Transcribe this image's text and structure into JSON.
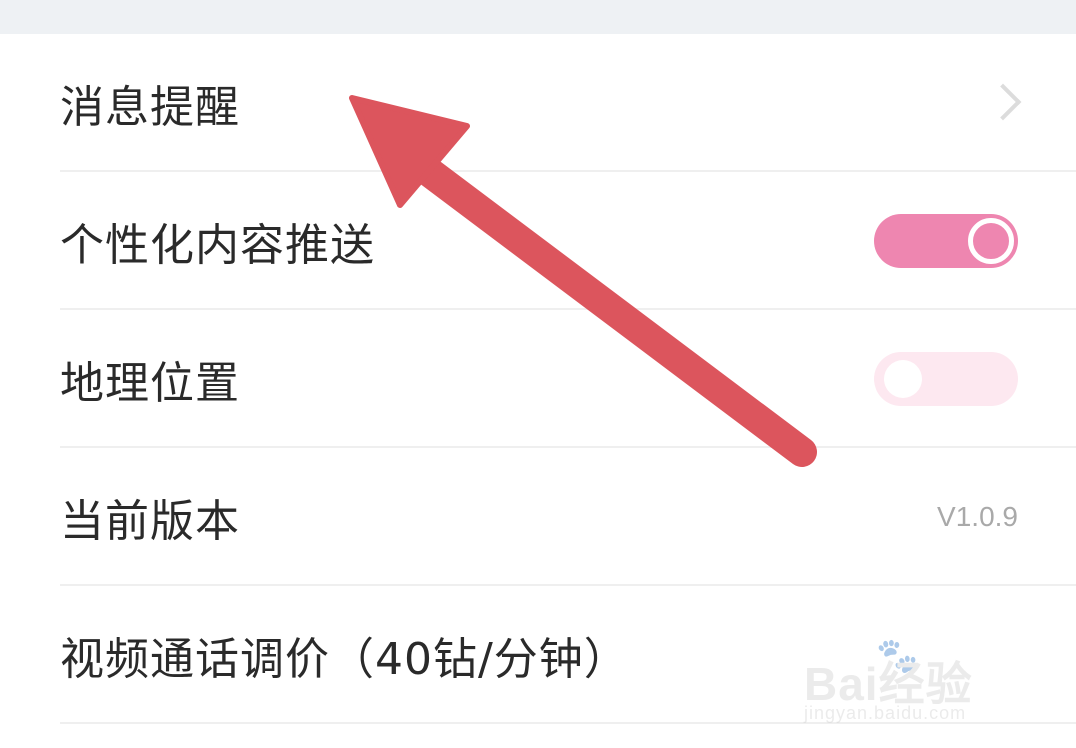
{
  "settings": {
    "items": [
      {
        "label": "消息提醒",
        "control": "chevron"
      },
      {
        "label": "个性化内容推送",
        "control": "toggle",
        "state": "on"
      },
      {
        "label": "地理位置",
        "control": "toggle",
        "state": "off"
      },
      {
        "label": "当前版本",
        "control": "value",
        "value": "V1.0.9"
      },
      {
        "label": "视频通话调价（40钻/分钟）",
        "control": "none"
      }
    ]
  },
  "annotation": {
    "type": "arrow",
    "color": "#dc555d",
    "points_to": "消息提醒"
  },
  "watermark": {
    "logo": "Bai经验",
    "url": "jingyan.baidu.com"
  },
  "colors": {
    "toggle_on": "#ee86b0",
    "toggle_off": "#fde8f0",
    "arrow": "#dc555d",
    "divider": "#efefef",
    "top_band": "#eef1f4"
  }
}
